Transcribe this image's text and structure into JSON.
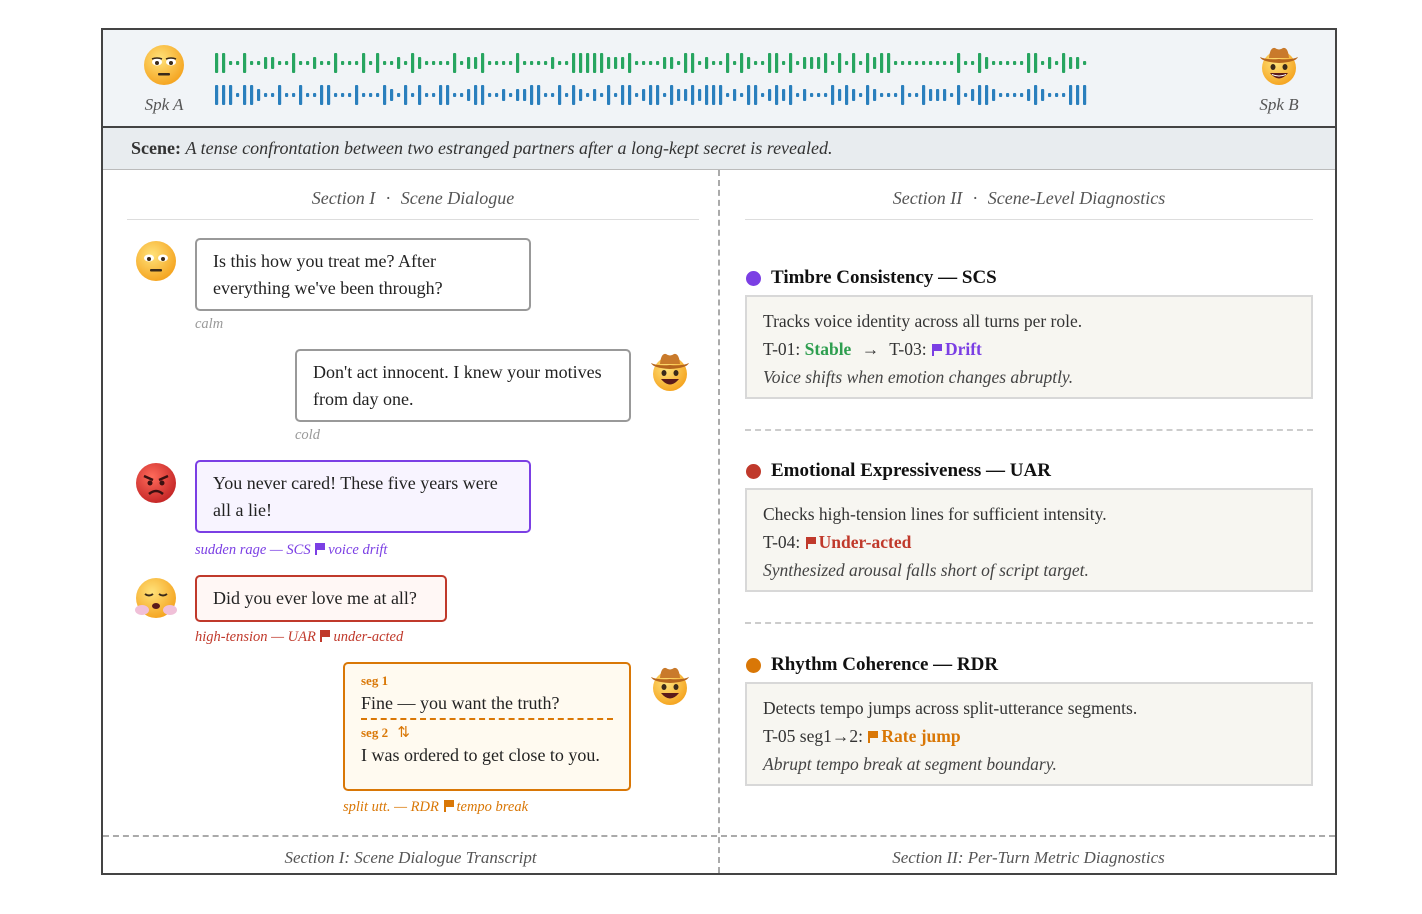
{
  "speakers": {
    "a_label": "Spk A",
    "b_label": "Spk B"
  },
  "scene": {
    "label": "Scene:",
    "text": "A tense confrontation between two estranged partners after a long-kept secret is revealed."
  },
  "section1": {
    "title_num": "Section I",
    "title_name": "Scene Dialogue",
    "footer": "Section I: Scene Dialogue Transcript"
  },
  "section2": {
    "title_num": "Section II",
    "title_name": "Scene-Level Diagnostics",
    "footer": "Section II: Per-Turn Metric Diagnostics"
  },
  "dialogue": [
    {
      "speaker": "A",
      "text": "Is this how you treat me? After everything we've been through?",
      "tag": "calm",
      "emotion_icon": "neutral-face-icon"
    },
    {
      "speaker": "B",
      "text": "Don't act innocent. I knew your motives from day one.",
      "tag": "cold",
      "emotion_icon": "cowboy-face-icon"
    },
    {
      "speaker": "A",
      "text": "You never cared! These five years were all a lie!",
      "tag_prefix": "sudden rage — SCS",
      "tag_flag": "voice drift",
      "emotion_icon": "angry-face-icon"
    },
    {
      "speaker": "A",
      "text": "Did you ever love me at all?",
      "tag_prefix": "high-tension — UAR",
      "tag_flag": "under-acted",
      "emotion_icon": "steaming-face-icon"
    },
    {
      "speaker": "B",
      "seg1_label": "seg 1",
      "seg1_text": "Fine — you want the truth?",
      "seg2_label": "seg 2",
      "seg2_mark": "⇅",
      "seg2_text": "I was ordered to get close to you.",
      "tag_prefix": "split utt. — RDR",
      "tag_flag": "tempo break",
      "emotion_icon": "cowboy-face-icon"
    }
  ],
  "metrics": [
    {
      "name": "Timbre Consistency — SCS",
      "color": "#7b3fe4",
      "desc": "Tracks voice identity across all turns per role.",
      "line_a": "T-01:",
      "status_a": "Stable",
      "arrow": "→",
      "line_b": "T-03:",
      "status_b": "Drift",
      "note": "Voice shifts when emotion changes abruptly."
    },
    {
      "name": "Emotional Expressiveness — UAR",
      "color": "#c0392b",
      "desc": "Checks high-tension lines for sufficient intensity.",
      "line_a": "T-04:",
      "status_b": "Under-acted",
      "note": "Synthesized arousal falls short of script target."
    },
    {
      "name": "Rhythm Coherence — RDR",
      "color": "#d97706",
      "desc": "Detects tempo jumps across split-utterance segments.",
      "line_a": "T-05 seg1→2:",
      "status_b": "Rate jump",
      "note": "Abrupt tempo break at segment boundary."
    }
  ],
  "colors": {
    "green_wave": "#27a560",
    "blue_wave": "#2a7fbd",
    "purple": "#7b3fe4",
    "red": "#c0392b",
    "orange": "#d97706",
    "stable_green": "#2e9e4f"
  }
}
